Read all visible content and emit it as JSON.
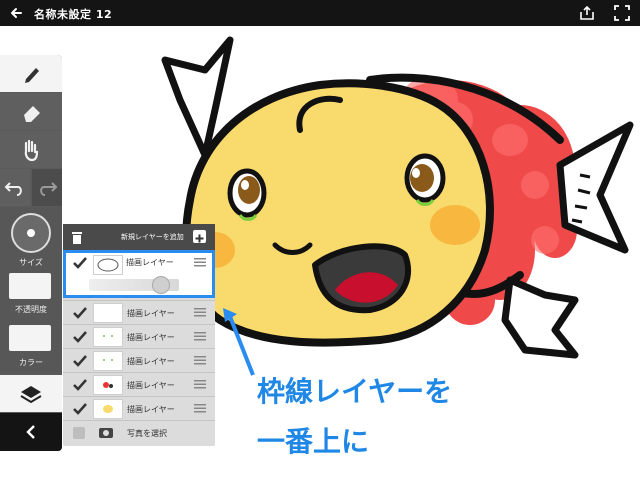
{
  "topbar": {
    "title": "名称未設定 12",
    "back_icon": "arrow-left-icon",
    "share_icon": "share-icon",
    "fullscreen_icon": "fullscreen-icon"
  },
  "toolbar": {
    "tools": [
      "pen-icon",
      "eraser-icon",
      "hand-icon",
      "undo-icon",
      "redo-icon"
    ],
    "size_label": "サイズ",
    "opacity_label": "不透明度",
    "color_label": "カラー",
    "layers_icon": "layers-icon",
    "collapse_icon": "chevron-left-icon"
  },
  "layers_panel": {
    "add_label": "新規レイヤーを追加",
    "rows": [
      {
        "name": "描画レイヤー",
        "checked": true,
        "selected": true,
        "opacity": 0.85
      },
      {
        "name": "描画レイヤー",
        "checked": true
      },
      {
        "name": "描画レイヤー",
        "checked": true
      },
      {
        "name": "描画レイヤー",
        "checked": true
      },
      {
        "name": "描画レイヤー",
        "checked": true
      },
      {
        "name": "描画レイヤー",
        "checked": true
      },
      {
        "name": "写真を選択",
        "checked": false
      }
    ]
  },
  "annotation": {
    "line1": "枠線レイヤーを",
    "line2": "一番上に"
  },
  "colors": {
    "fish_body": "#f9da6c",
    "fish_red": "#f04949",
    "cheek": "#f7b23a",
    "annotation": "#1f87e5",
    "selection": "#2a8cf0"
  }
}
